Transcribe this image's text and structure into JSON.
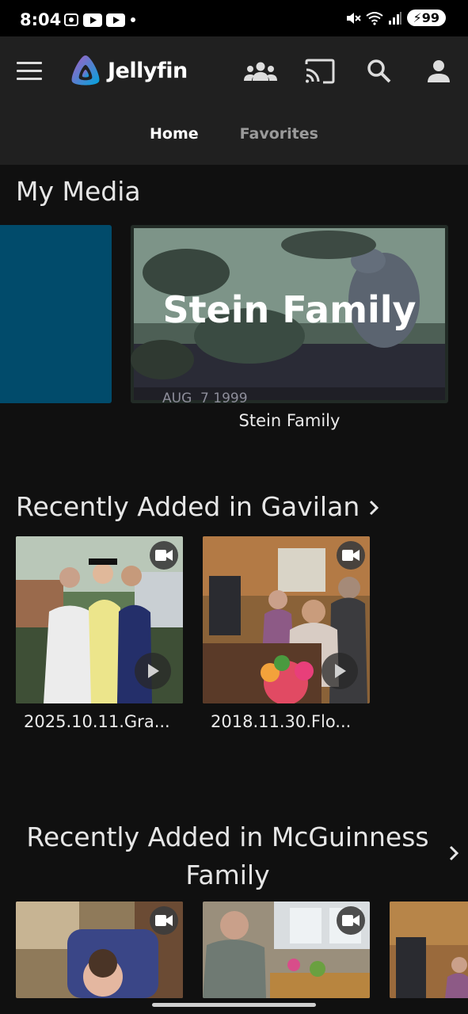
{
  "status_bar": {
    "time": "8:04",
    "battery": "99"
  },
  "header": {
    "app_name": "Jellyfin"
  },
  "tabs": [
    {
      "label": "Home"
    },
    {
      "label": "Favorites"
    }
  ],
  "my_media": {
    "title": "My Media",
    "libraries": [
      {
        "label": "Stein Family",
        "overlay_title": "Stein Family",
        "stamp": "AUG  7 1999"
      }
    ]
  },
  "recent_gavilan": {
    "title": "Recently Added in Gavilan",
    "items": [
      {
        "label": "2025.10.11.Gra..."
      },
      {
        "label": "2018.11.30.Flo..."
      }
    ]
  },
  "recent_mcguinness": {
    "title_line1": "Recently Added in McGuinness",
    "title_line2": "Family"
  }
}
